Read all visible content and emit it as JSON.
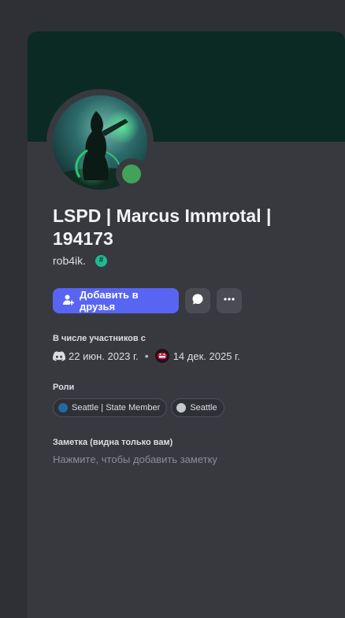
{
  "profile": {
    "display_name": "LSPD | Marcus Immrotal | 194173",
    "username": "rob4ik.",
    "username_badge": "#",
    "status": "online",
    "colors": {
      "banner": "#0b2a24",
      "card": "#38393f",
      "status_online": "#43a25a",
      "primary_button": "#5865f2",
      "badge": "#1dbb8d"
    }
  },
  "actions": {
    "add_friend_label": "Добавить в друзья",
    "add_friend_icon": "add-user-icon",
    "message_icon": "message-bubble-icon",
    "more_icon": "ellipsis-icon"
  },
  "member_since": {
    "title": "В числе участников с",
    "discord_icon": "discord-icon",
    "discord_date": "22 июн. 2023 г.",
    "separator": "•",
    "server_icon": "server-icon",
    "server_date": "14 дек. 2025 г."
  },
  "roles": {
    "title": "Роли",
    "items": [
      {
        "name": "Seattle | State Member",
        "color": "#1f6aa5"
      },
      {
        "name": "Seattle",
        "color": "#c4c9ce"
      }
    ]
  },
  "note": {
    "title": "Заметка (видна только вам)",
    "placeholder": "Нажмите, чтобы добавить заметку"
  }
}
